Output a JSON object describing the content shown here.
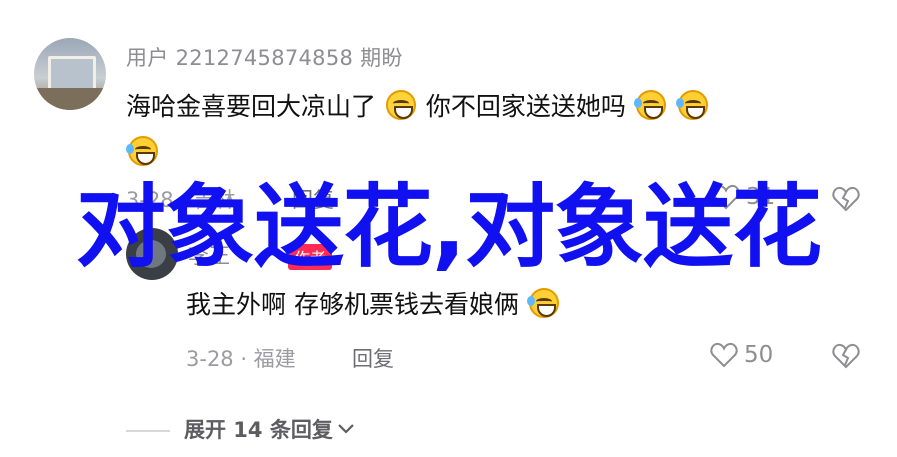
{
  "comment": {
    "username": "用户 2212745874858 期盼",
    "text_part1": "海哈金喜要回大凉山了",
    "text_part2": "你不回家送送她吗",
    "date_location": "3-28 · 吉林",
    "reply_label": "回复",
    "likes": "31"
  },
  "reply": {
    "username": "李正",
    "badge": "作者",
    "text": "我主外啊 存够机票钱去看娘俩",
    "date_location": "3-28 · 福建",
    "reply_label": "回复",
    "likes": "50"
  },
  "expand": {
    "label": "展开 14 条回复"
  },
  "overlay": {
    "text": "对象送花,对象送花"
  },
  "colors": {
    "overlay": "#1010f0",
    "badge": "#fe2c55",
    "meta": "#9b9ba0"
  },
  "icons": [
    "grin-emoji",
    "tears-of-joy-emoji",
    "heart-icon",
    "broken-heart-icon",
    "chevron-down-icon"
  ]
}
